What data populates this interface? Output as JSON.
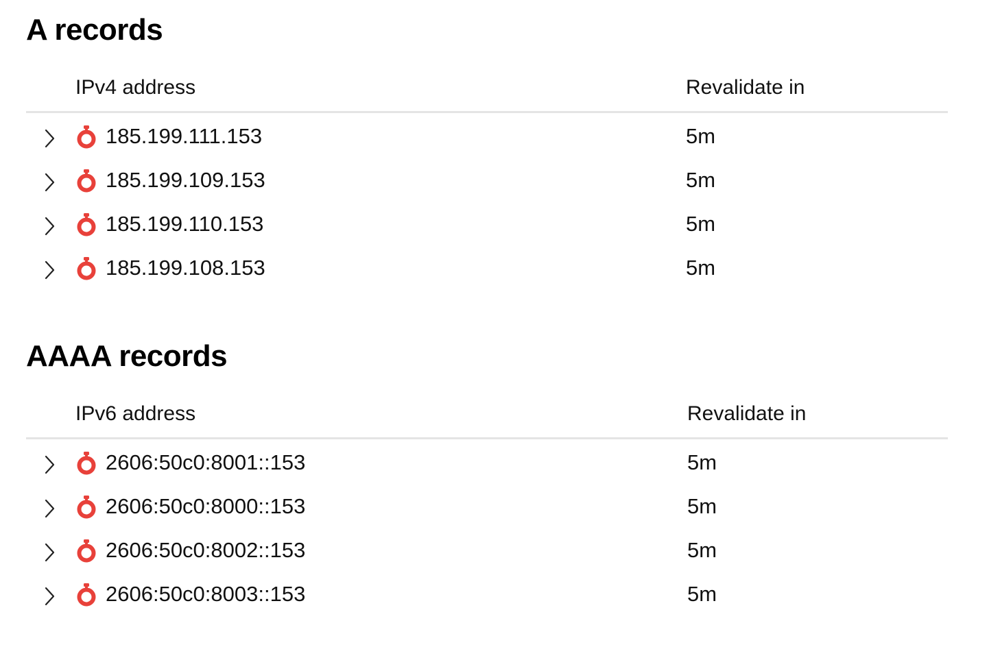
{
  "a_records": {
    "title": "A records",
    "columns": {
      "address": "IPv4 address",
      "revalidate": "Revalidate in"
    },
    "rows": [
      {
        "address": "185.199.111.153",
        "revalidate": "5m",
        "icon": "stopwatch-icon"
      },
      {
        "address": "185.199.109.153",
        "revalidate": "5m",
        "icon": "stopwatch-icon"
      },
      {
        "address": "185.199.110.153",
        "revalidate": "5m",
        "icon": "stopwatch-icon"
      },
      {
        "address": "185.199.108.153",
        "revalidate": "5m",
        "icon": "stopwatch-icon"
      }
    ]
  },
  "aaaa_records": {
    "title": "AAAA records",
    "columns": {
      "address": "IPv6 address",
      "revalidate": "Revalidate in"
    },
    "rows": [
      {
        "address": "2606:50c0:8001::153",
        "revalidate": "5m",
        "icon": "stopwatch-icon"
      },
      {
        "address": "2606:50c0:8000::153",
        "revalidate": "5m",
        "icon": "stopwatch-icon"
      },
      {
        "address": "2606:50c0:8002::153",
        "revalidate": "5m",
        "icon": "stopwatch-icon"
      },
      {
        "address": "2606:50c0:8003::153",
        "revalidate": "5m",
        "icon": "stopwatch-icon"
      }
    ]
  },
  "colors": {
    "status_icon": "#e8413a",
    "divider": "#e4e4e4",
    "text": "#111111"
  }
}
